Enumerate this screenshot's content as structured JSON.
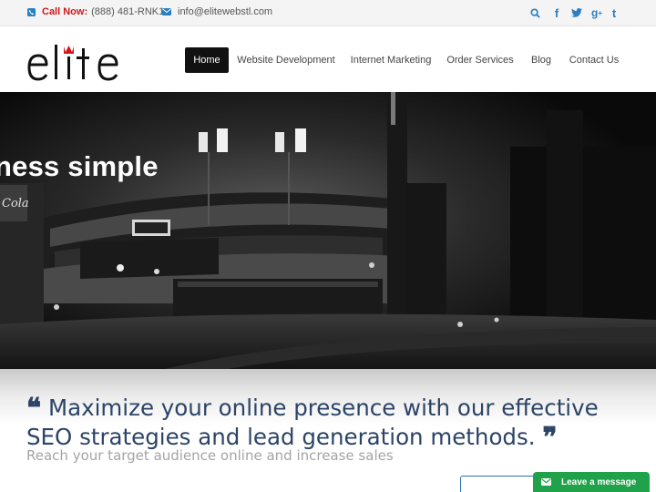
{
  "topbar": {
    "call_label": "Call Now:",
    "phone": "(888) 481-RNK1",
    "email": "info@elitewebstl.com",
    "social": [
      "search-icon",
      "facebook-icon",
      "twitter-icon",
      "google-plus-icon",
      "tumblr-icon"
    ],
    "accent": "#d0171b",
    "icon_color": "#2a7fc1"
  },
  "logo": {
    "text": "elite"
  },
  "nav": {
    "items": [
      "Home",
      "Website Development",
      "Internet Marketing",
      "Order Services",
      "Blog",
      "Contact Us"
    ],
    "active": "Home"
  },
  "hero": {
    "title": "ness simple"
  },
  "quote": {
    "text": "Maximize your online presence with our effective SEO strategies and lead generation methods.",
    "subtitle": "Reach your target audience online and increase sales",
    "color": "#2c4466"
  },
  "chat": {
    "label": "Leave a message",
    "color": "#1fa24a"
  }
}
